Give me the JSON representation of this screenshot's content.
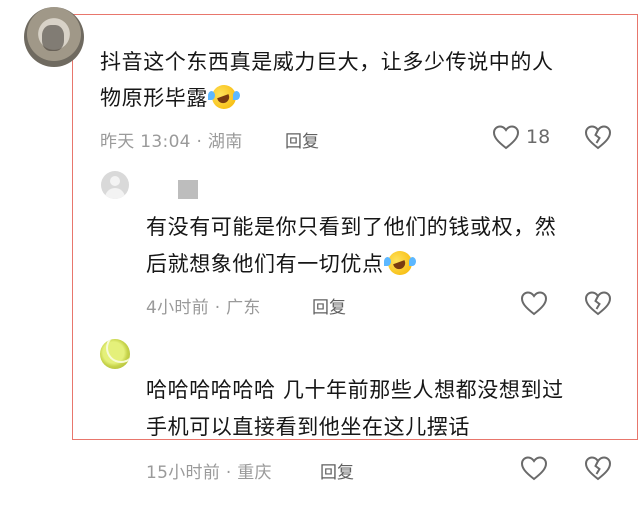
{
  "comments": [
    {
      "text_line1": "抖音这个东西真是威力巨大，让多少传说中的人",
      "text_line2": "物原形毕露",
      "time_location": "昨天 13:04 · 湖南",
      "reply_label": "回复",
      "like_count": "18"
    },
    {
      "text_line1": "有没有可能是你只看到了他们的钱或权，然",
      "text_line2": "后就想象他们有一切优点",
      "time_location": "4小时前 · 广东",
      "reply_label": "回复"
    },
    {
      "text_line1": "哈哈哈哈哈哈 几十年前那些人想都没想到过",
      "text_line2": "手机可以直接看到他坐在这儿摆话",
      "time_location": "15小时前 · 重庆",
      "reply_label": "回复"
    }
  ],
  "colors": {
    "highlight_border": "#e8766c",
    "meta_text": "#9a9a9a",
    "reply_text": "#616161"
  },
  "icons": {
    "like": "heart-outline-icon",
    "dislike": "broken-heart-icon",
    "emoji": "laughing-crying-emoji-icon"
  }
}
